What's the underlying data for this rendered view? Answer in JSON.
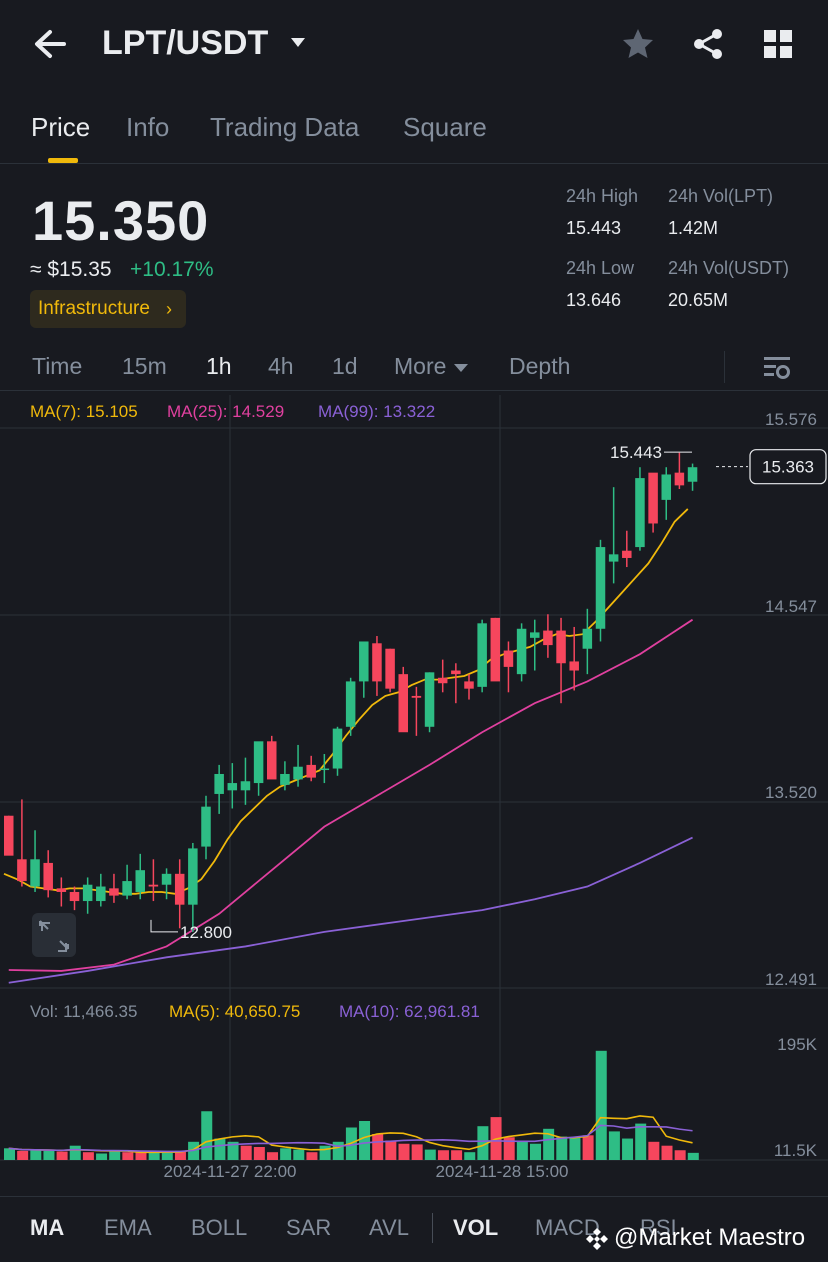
{
  "header": {
    "pair": "LPT/USDT",
    "icons": [
      "back-arrow-icon",
      "caret-down-icon",
      "star-icon",
      "share-icon",
      "grid-icon"
    ]
  },
  "tabs": [
    "Price",
    "Info",
    "Trading Data",
    "Square"
  ],
  "summary": {
    "last_price": "15.350",
    "usd_price": "≈ $15.35",
    "change": "+10.17%",
    "tag": "Infrastructure",
    "high_label": "24h High",
    "high_value": "15.443",
    "vol_lpt_label": "24h Vol(LPT)",
    "vol_lpt_value": "1.42M",
    "low_label": "24h Low",
    "low_value": "13.646",
    "vol_usdt_label": "24h Vol(USDT)",
    "vol_usdt_value": "20.65M"
  },
  "intervals": [
    "Time",
    "15m",
    "1h",
    "4h",
    "1d",
    "More",
    "Depth"
  ],
  "colors": {
    "up": "#2ebd85",
    "down": "#f6465d",
    "ma7": "#f0b90b",
    "ma25": "#e0409f",
    "ma99": "#8a61d6",
    "accent": "#f0b90b",
    "background": "#181a20"
  },
  "ma_legend": {
    "ma7": "MA(7): 15.105",
    "ma25": "MA(25): 14.529",
    "ma99": "MA(99): 13.322"
  },
  "vol_legend": {
    "vol": "Vol: 11,466.35",
    "ma5": "MA(5): 40,650.75",
    "ma10": "MA(10): 62,961.81"
  },
  "chart_data": {
    "type": "candlestick",
    "price_axis_labels": [
      "15.576",
      "14.547",
      "13.520",
      "12.491"
    ],
    "price_ylim": [
      12.491,
      15.576
    ],
    "current_price_label": "15.363",
    "high_marker": "15.443",
    "low_marker": "12.800",
    "x_labels": [
      "2024-11-27 22:00",
      "2024-11-28 15:00"
    ],
    "vol_axis_labels": [
      "195K",
      "11.5K"
    ],
    "vol_ylim": [
      0,
      200
    ],
    "vol_unit": "K",
    "candles": [
      [
        13.44,
        13.44,
        13.28,
        13.22
      ],
      [
        13.2,
        13.53,
        13.05,
        13.08
      ],
      [
        13.05,
        13.36,
        13.02,
        13.2
      ],
      [
        13.18,
        13.25,
        12.99,
        13.03
      ],
      [
        13.04,
        13.1,
        12.94,
        13.02
      ],
      [
        13.02,
        13.05,
        12.92,
        12.97
      ],
      [
        12.97,
        13.1,
        12.9,
        13.06
      ],
      [
        12.97,
        13.12,
        12.94,
        13.05
      ],
      [
        13.04,
        13.12,
        12.96,
        13.0
      ],
      [
        13.0,
        13.17,
        12.98,
        13.08
      ],
      [
        13.02,
        13.23,
        12.98,
        13.14
      ],
      [
        13.06,
        13.2,
        12.97,
        13.05
      ],
      [
        13.06,
        13.15,
        12.98,
        13.12
      ],
      [
        13.12,
        13.2,
        12.82,
        12.95
      ],
      [
        12.95,
        13.29,
        12.8,
        13.26
      ],
      [
        13.27,
        13.55,
        13.2,
        13.49
      ],
      [
        13.56,
        13.72,
        13.45,
        13.67
      ],
      [
        13.58,
        13.73,
        13.48,
        13.62
      ],
      [
        13.58,
        13.76,
        13.5,
        13.63
      ],
      [
        13.62,
        13.82,
        13.55,
        13.85
      ],
      [
        13.85,
        13.88,
        13.65,
        13.64
      ],
      [
        13.61,
        13.74,
        13.58,
        13.67
      ],
      [
        13.64,
        13.83,
        13.6,
        13.71
      ],
      [
        13.72,
        13.77,
        13.63,
        13.65
      ],
      [
        13.7,
        13.78,
        13.62,
        13.7
      ],
      [
        13.7,
        13.93,
        13.66,
        13.92
      ],
      [
        13.93,
        14.2,
        13.88,
        14.18
      ],
      [
        14.18,
        14.38,
        14.09,
        14.4
      ],
      [
        14.39,
        14.43,
        14.1,
        14.18
      ],
      [
        14.36,
        14.36,
        14.12,
        14.14
      ],
      [
        14.22,
        14.26,
        13.95,
        13.9
      ],
      [
        14.1,
        14.15,
        13.88,
        14.09
      ],
      [
        13.93,
        14.23,
        13.9,
        14.23
      ],
      [
        14.2,
        14.3,
        14.12,
        14.17
      ],
      [
        14.24,
        14.28,
        14.06,
        14.22
      ],
      [
        14.18,
        14.22,
        14.08,
        14.14
      ],
      [
        14.15,
        14.52,
        14.12,
        14.5
      ],
      [
        14.53,
        14.53,
        14.2,
        14.18
      ],
      [
        14.35,
        14.4,
        14.12,
        14.26
      ],
      [
        14.22,
        14.5,
        14.18,
        14.47
      ],
      [
        14.42,
        14.52,
        14.24,
        14.45
      ],
      [
        14.46,
        14.55,
        14.31,
        14.38
      ],
      [
        14.46,
        14.53,
        14.06,
        14.28
      ],
      [
        14.29,
        14.48,
        14.13,
        14.24
      ],
      [
        14.36,
        14.58,
        14.22,
        14.47
      ],
      [
        14.47,
        14.96,
        14.4,
        14.92
      ],
      [
        14.84,
        15.25,
        14.72,
        14.88
      ],
      [
        14.9,
        15.01,
        14.81,
        14.86
      ],
      [
        14.92,
        15.36,
        14.9,
        15.3
      ],
      [
        15.33,
        15.3,
        15.0,
        15.05
      ],
      [
        15.18,
        15.36,
        15.07,
        15.32
      ],
      [
        15.33,
        15.44,
        15.24,
        15.26
      ],
      [
        15.28,
        15.38,
        15.23,
        15.36
      ]
    ],
    "ma7": [
      [
        13.08,
        13.12
      ],
      [
        13.11,
        13.09
      ],
      [
        13.14,
        13.05
      ],
      [
        13.17,
        13.04
      ],
      [
        13.21,
        13.03
      ],
      [
        13.27,
        13.04
      ],
      [
        13.33,
        13.04
      ],
      [
        13.39,
        13.03
      ],
      [
        13.45,
        13.02
      ],
      [
        13.51,
        13.01
      ],
      [
        13.57,
        13.01
      ],
      [
        13.63,
        13.02
      ],
      [
        13.69,
        13.02
      ],
      [
        13.75,
        13.01
      ],
      [
        13.8,
        13.04
      ],
      [
        13.86,
        13.09
      ],
      [
        13.92,
        13.19
      ],
      [
        13.97,
        13.31
      ],
      [
        14.03,
        13.41
      ],
      [
        14.08,
        13.48
      ],
      [
        14.14,
        13.55
      ],
      [
        14.19,
        13.6
      ],
      [
        14.25,
        13.63
      ],
      [
        14.31,
        13.66
      ],
      [
        14.37,
        13.69
      ],
      [
        14.43,
        13.78
      ],
      [
        14.48,
        13.88
      ],
      [
        14.54,
        13.97
      ],
      [
        14.6,
        14.05
      ],
      [
        14.66,
        14.1
      ],
      [
        14.72,
        14.12
      ],
      [
        14.78,
        14.16
      ],
      [
        14.83,
        14.19
      ],
      [
        14.89,
        14.19
      ],
      [
        14.95,
        14.2
      ],
      [
        15.01,
        14.21
      ],
      [
        15.06,
        14.24
      ],
      [
        15.12,
        14.3
      ],
      [
        15.18,
        14.33
      ],
      [
        15.24,
        14.35
      ],
      [
        15.3,
        14.37
      ],
      [
        15.35,
        14.41
      ],
      [
        15.41,
        14.44
      ],
      [
        15.47,
        14.43
      ],
      [
        15.53,
        14.44
      ],
      [
        15.59,
        14.51
      ],
      [
        15.64,
        14.59
      ],
      [
        15.7,
        14.67
      ],
      [
        15.76,
        14.75
      ],
      [
        15.82,
        14.83
      ],
      [
        15.88,
        14.94
      ],
      [
        15.93,
        15.06
      ],
      [
        15.99,
        15.13
      ]
    ],
    "ma25_start": [
      12.58,
      12.605
    ],
    "ma25_end": [
      12.79,
      14.53
    ],
    "ma99_start": [
      12.52,
      12.535
    ],
    "ma99_end": [
      12.78,
      13.32
    ],
    "volumes": [
      [
        18,
        0
      ],
      [
        14,
        1
      ],
      [
        15,
        0
      ],
      [
        14,
        0
      ],
      [
        13,
        1
      ],
      [
        22,
        0
      ],
      [
        12,
        1
      ],
      [
        10,
        0
      ],
      [
        13,
        0
      ],
      [
        12,
        1
      ],
      [
        12,
        1
      ],
      [
        12,
        0
      ],
      [
        11,
        0
      ],
      [
        14,
        1
      ],
      [
        28,
        0
      ],
      [
        75,
        0
      ],
      [
        33,
        0
      ],
      [
        28,
        0
      ],
      [
        22,
        1
      ],
      [
        20,
        1
      ],
      [
        12,
        1
      ],
      [
        18,
        0
      ],
      [
        16,
        0
      ],
      [
        12,
        1
      ],
      [
        22,
        0
      ],
      [
        28,
        0
      ],
      [
        50,
        0
      ],
      [
        60,
        0
      ],
      [
        40,
        1
      ],
      [
        30,
        1
      ],
      [
        25,
        1
      ],
      [
        24,
        1
      ],
      [
        16,
        0
      ],
      [
        15,
        1
      ],
      [
        15,
        1
      ],
      [
        12,
        0
      ],
      [
        52,
        0
      ],
      [
        66,
        1
      ],
      [
        35,
        1
      ],
      [
        28,
        0
      ],
      [
        25,
        0
      ],
      [
        48,
        0
      ],
      [
        36,
        0
      ],
      [
        35,
        0
      ],
      [
        38,
        1
      ],
      [
        168,
        0
      ],
      [
        44,
        0
      ],
      [
        33,
        0
      ],
      [
        56,
        0
      ],
      [
        28,
        1
      ],
      [
        22,
        1
      ],
      [
        15,
        1
      ],
      [
        11,
        0
      ]
    ]
  },
  "indicators": [
    "MA",
    "EMA",
    "BOLL",
    "SAR",
    "AVL",
    "VOL",
    "MACD",
    "RSI"
  ],
  "watermark": "@Market Maestro"
}
